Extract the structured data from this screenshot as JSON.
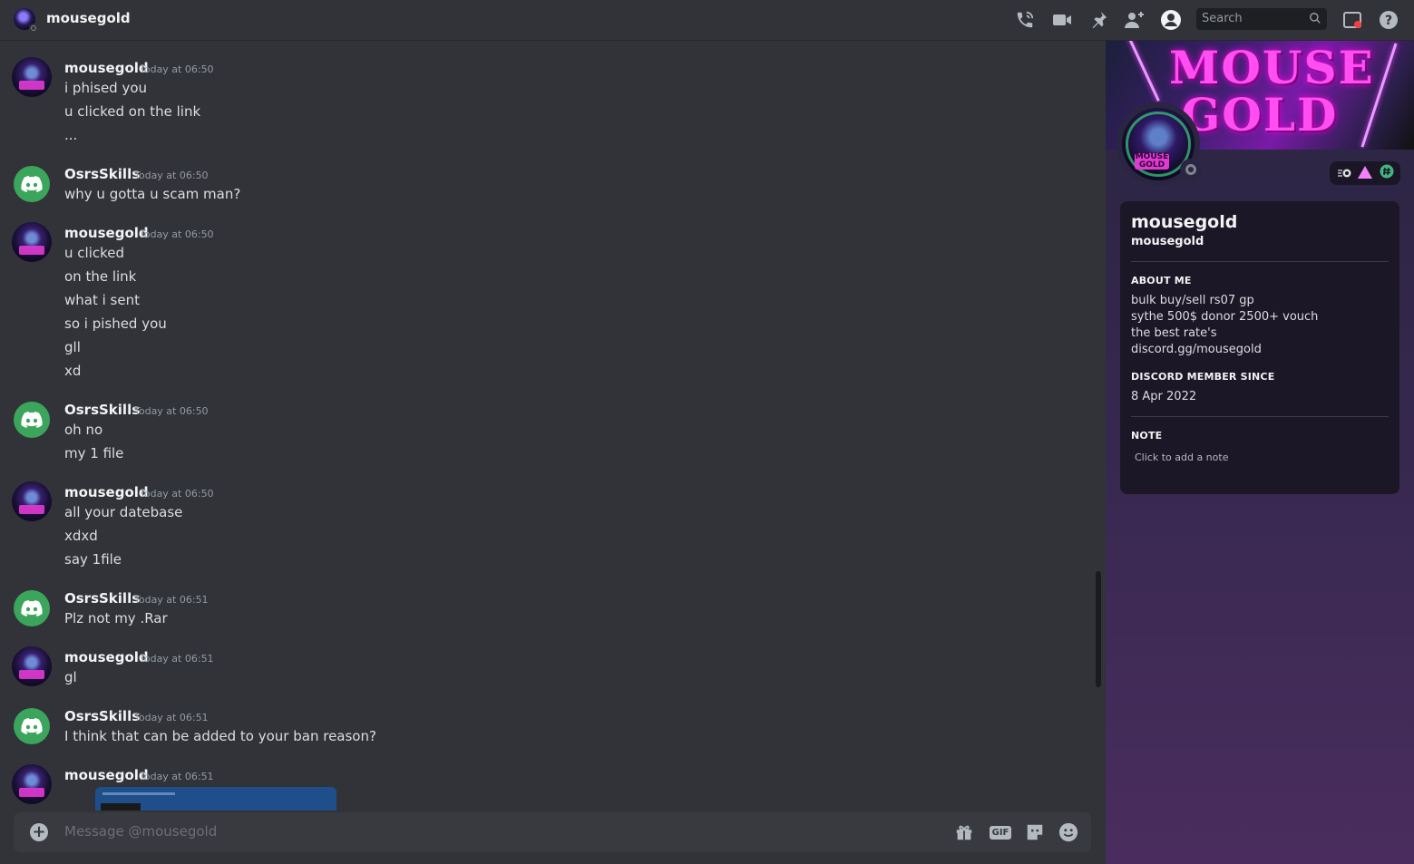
{
  "header": {
    "title": "mousegold",
    "search_placeholder": "Search"
  },
  "messages": [
    {
      "author": "mousegold",
      "timestamp": "Today at 06:50",
      "lines": [
        "i phised you",
        "u clicked on the link",
        "..."
      ]
    },
    {
      "author": "OsrsSkills",
      "timestamp": "Today at 06:50",
      "lines": [
        "why u gotta u scam man?"
      ]
    },
    {
      "author": "mousegold",
      "timestamp": "Today at 06:50",
      "lines": [
        "u clicked",
        "on the link",
        "what i sent",
        "so i pished you",
        "gll",
        "xd"
      ]
    },
    {
      "author": "OsrsSkills",
      "timestamp": "Today at 06:50",
      "lines": [
        "oh no",
        "my 1 file"
      ]
    },
    {
      "author": "mousegold",
      "timestamp": "Today at 06:50",
      "lines": [
        "all your datebase",
        "xdxd",
        "say 1file"
      ]
    },
    {
      "author": "OsrsSkills",
      "timestamp": "Today at 06:51",
      "lines": [
        "Plz not my .Rar"
      ]
    },
    {
      "author": "mousegold",
      "timestamp": "Today at 06:51",
      "lines": [
        "gl"
      ]
    },
    {
      "author": "OsrsSkills",
      "timestamp": "Today at 06:51",
      "lines": [
        "I think that can be added to your ban reason?"
      ]
    },
    {
      "author": "mousegold",
      "timestamp": "Today at 06:51",
      "lines": []
    }
  ],
  "composer": {
    "placeholder": "Message @mousegold",
    "gif_label": "GIF"
  },
  "profile": {
    "banner_text_1": "MOUSE",
    "banner_text_2": "GOLD",
    "display_name": "mousegold",
    "username": "mousegold",
    "about_header": "ABOUT ME",
    "about_lines": [
      "bulk buy/sell rs07 gp",
      "sythe 500$ donor 2500+ vouch",
      "the best rate's",
      "discord.gg/mousegold"
    ],
    "member_since_header": "DISCORD MEMBER SINCE",
    "member_since": "8 Apr 2022",
    "note_header": "NOTE",
    "note_placeholder": "Click to add a note"
  },
  "colors": {
    "background": "#313338",
    "discord_green": "#3ba55c",
    "accent_pink": "#e13ad4"
  }
}
